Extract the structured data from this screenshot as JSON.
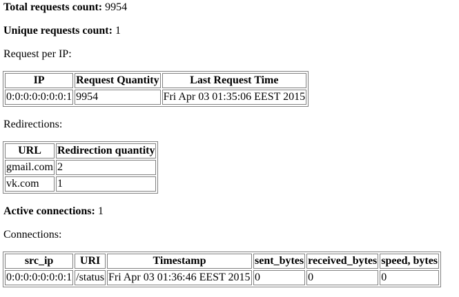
{
  "summary": {
    "total_label": "Total requests count:",
    "total_value": "9954",
    "unique_label": "Unique requests count:",
    "unique_value": "1"
  },
  "per_ip": {
    "heading": "Request per IP:",
    "headers": [
      "IP",
      "Request Quantity",
      "Last Request Time"
    ],
    "rows": [
      [
        "0:0:0:0:0:0:0:1",
        "9954",
        "Fri Apr 03 01:35:06 EEST 2015"
      ]
    ]
  },
  "redirections": {
    "heading": "Redirections:",
    "headers": [
      "URL",
      "Redirection quantity"
    ],
    "rows": [
      [
        "gmail.com",
        "2"
      ],
      [
        "vk.com",
        "1"
      ]
    ]
  },
  "active": {
    "label": "Active connections:",
    "value": "1"
  },
  "connections": {
    "heading": "Connections:",
    "headers": [
      "src_ip",
      "URI",
      "Timestamp",
      "sent_bytes",
      "received_bytes",
      "speed, bytes"
    ],
    "rows": [
      [
        "0:0:0:0:0:0:0:1",
        "/status",
        "Fri Apr 03 01:36:46 EEST 2015",
        "0",
        "0",
        "0"
      ]
    ]
  }
}
